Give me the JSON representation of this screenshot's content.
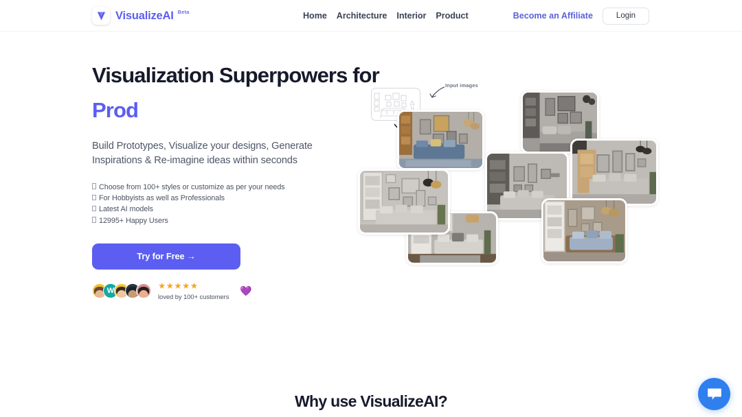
{
  "header": {
    "brand_name": "VisualizeAI",
    "brand_badge": "Beta",
    "logo_icon": "logo-v-icon",
    "nav": [
      {
        "label": "Home"
      },
      {
        "label": "Architecture"
      },
      {
        "label": "Interior"
      },
      {
        "label": "Product"
      }
    ],
    "affiliate_label": "Become an Affiliate",
    "login_label": "Login"
  },
  "hero": {
    "headline": "Visualization Superpowers for",
    "headline_accent": "Prod",
    "subhead": "Build Prototypes, Visualize your designs, Generate Inspirations & Re-imagine ideas within seconds",
    "bullets": [
      {
        "text": "Choose from 100+ styles or customize as per your needs"
      },
      {
        "text": "For Hobbyists as well as Professionals"
      },
      {
        "text": "Latest AI models"
      },
      {
        "text": "12995+ Happy Users"
      }
    ],
    "cta_label": "Try for Free  →",
    "social_proof": {
      "stars": "★★★★★",
      "star_count": 5,
      "caption": "loved by 100+ customers",
      "heart": "💜",
      "avatars": [
        {
          "name": "avatar-1",
          "bg": "#f2c230",
          "letter": ""
        },
        {
          "name": "avatar-2",
          "bg": "#15a9a2",
          "letter": "W"
        },
        {
          "name": "avatar-3",
          "bg": "#efc732",
          "letter": ""
        },
        {
          "name": "avatar-4",
          "bg": "#2b3440",
          "letter": ""
        },
        {
          "name": "avatar-5",
          "bg": "#d98f96",
          "letter": ""
        }
      ]
    },
    "illustration": {
      "input_label": "Input images",
      "sketch_alt": "line-art living room sketch"
    }
  },
  "below_fold": {
    "section_title": "Why use VisualizeAI?"
  },
  "chat": {
    "icon": "chat-bubble-icon"
  },
  "colors": {
    "brand_purple": "#5b5ef0",
    "headline_dark": "#161a2b",
    "body_gray": "#4e5668",
    "star_gold": "#f5a623",
    "chat_blue": "#2f7fef",
    "heart_purple": "#8b5cf6"
  }
}
